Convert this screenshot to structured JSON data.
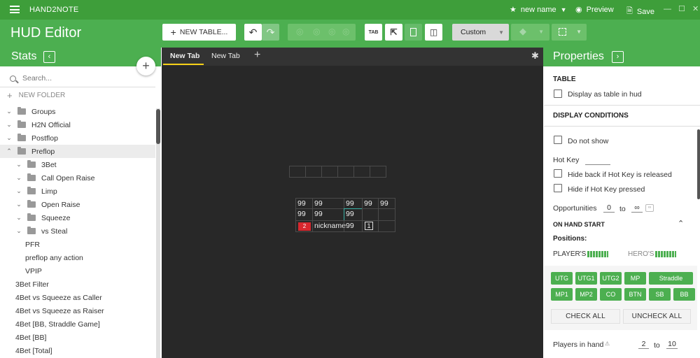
{
  "app": {
    "name": "HAND2NOTE"
  },
  "titlebar": {
    "doc_name": "new name",
    "preview": "Preview",
    "save": "Save",
    "minimize": "—",
    "maximize": "☐",
    "close": "✕"
  },
  "toolbar": {
    "title": "HUD Editor",
    "new_table": "NEW TABLE...",
    "tab_icon": "TAB",
    "custom": "Custom"
  },
  "stats": {
    "title": "Stats",
    "collapse": "‹",
    "add": "+",
    "search_placeholder": "Search...",
    "new_folder": "NEW FOLDER",
    "items": [
      {
        "label": "Groups",
        "chev": "⌄",
        "folder": true,
        "indent": 0
      },
      {
        "label": "H2N Official",
        "chev": "⌄",
        "folder": true,
        "indent": 0
      },
      {
        "label": "Postflop",
        "chev": "⌄",
        "folder": true,
        "indent": 0
      },
      {
        "label": "Preflop",
        "chev": "⌃",
        "folder": true,
        "indent": 0,
        "selected": true
      },
      {
        "label": "3Bet",
        "chev": "⌄",
        "folder": true,
        "indent": 1
      },
      {
        "label": "Call Open Raise",
        "chev": "⌄",
        "folder": true,
        "indent": 1
      },
      {
        "label": "Limp",
        "chev": "⌄",
        "folder": true,
        "indent": 1
      },
      {
        "label": "Open Raise",
        "chev": "⌄",
        "folder": true,
        "indent": 1
      },
      {
        "label": "Squeeze",
        "chev": "⌄",
        "folder": true,
        "indent": 1
      },
      {
        "label": "vs Steal",
        "chev": "⌄",
        "folder": true,
        "indent": 1
      },
      {
        "label": "PFR",
        "chev": "",
        "folder": false,
        "indent": 2
      },
      {
        "label": "preflop any action",
        "chev": "",
        "folder": false,
        "indent": 2
      },
      {
        "label": "VPIP",
        "chev": "",
        "folder": false,
        "indent": 2
      },
      {
        "label": "3Bet Filter",
        "chev": "",
        "folder": false,
        "indent": 3
      },
      {
        "label": "4Bet vs Squeeze as Caller",
        "chev": "",
        "folder": false,
        "indent": 3
      },
      {
        "label": "4Bet vs Squeeze as Raiser",
        "chev": "",
        "folder": false,
        "indent": 3
      },
      {
        "label": "4Bet [BB, Straddle Game]",
        "chev": "",
        "folder": false,
        "indent": 3
      },
      {
        "label": "4Bet [BB]",
        "chev": "",
        "folder": false,
        "indent": 3
      },
      {
        "label": "4Bet [Total]",
        "chev": "",
        "folder": false,
        "indent": 3
      }
    ]
  },
  "editor": {
    "tabs": [
      "New Tab",
      "New Tab"
    ],
    "add_tab": "+",
    "settings": "✱",
    "hud": {
      "row1": [
        "99",
        "99",
        "",
        "99",
        "99",
        "99"
      ],
      "row2": [
        "99",
        "99",
        "",
        "99",
        "",
        ""
      ],
      "row3_badge": "2",
      "row3_nick": "nickname",
      "row3_val": "99",
      "row3_box": "1"
    }
  },
  "properties": {
    "title": "Properties",
    "expand": "›",
    "table_heading": "TABLE",
    "display_as_table": "Display as table in hud",
    "display_conditions": "DISPLAY CONDITIONS",
    "do_not_show": "Do not show",
    "hot_key": "Hot Key",
    "hide_back": "Hide back if Hot Key is released",
    "hide_pressed": "Hide if Hot Key pressed",
    "opportunities": "Opportunities",
    "opp_from": "0",
    "opp_to_word": "to",
    "opp_to": "∞",
    "on_hand_start": "ON HAND START",
    "positions": "Positions:",
    "players": "PLAYER'S",
    "heroes": "HERO'S",
    "pos_row1": [
      "UTG",
      "UTG1",
      "UTG2",
      "MP",
      "Straddle"
    ],
    "pos_row2": [
      "MP1",
      "MP2",
      "CO",
      "BTN",
      "SB",
      "BB"
    ],
    "check_all": "CHECK ALL",
    "uncheck_all": "UNCHECK ALL",
    "players_in_hand": "Players in hand",
    "pih_from": "2",
    "pih_to_word": "to",
    "pih_to": "10"
  },
  "colors": {
    "brand": "#4caf50",
    "titlebar": "#3e9e3a",
    "editor_bg": "#282828",
    "tab_accent": "#f7d117"
  }
}
